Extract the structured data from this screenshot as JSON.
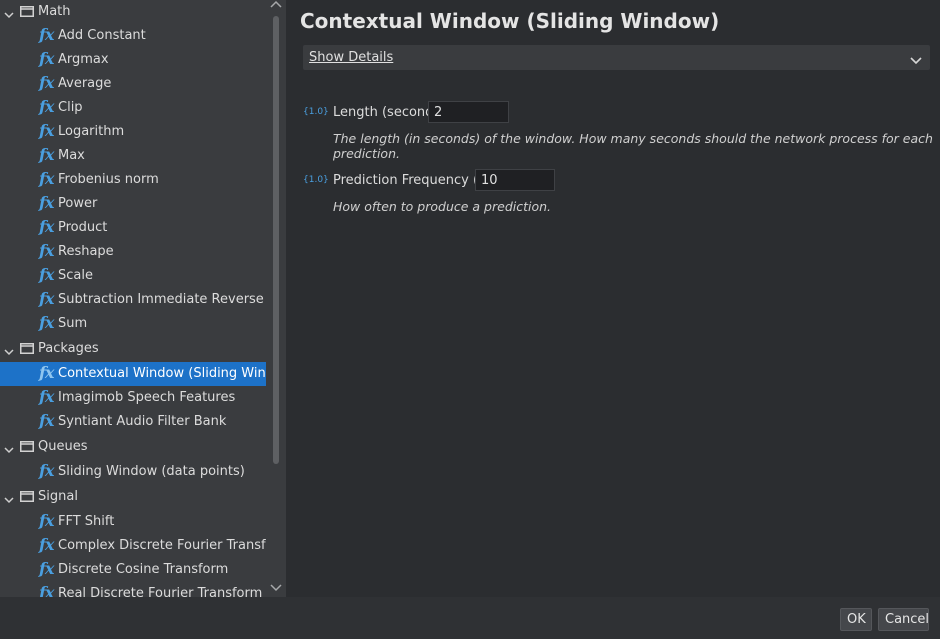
{
  "sidebar": {
    "rows": [
      {
        "kind": "folder",
        "label": "Math"
      },
      {
        "kind": "item",
        "label": "Add Constant"
      },
      {
        "kind": "item",
        "label": "Argmax"
      },
      {
        "kind": "item",
        "label": "Average"
      },
      {
        "kind": "item",
        "label": "Clip"
      },
      {
        "kind": "item",
        "label": "Logarithm"
      },
      {
        "kind": "item",
        "label": "Max"
      },
      {
        "kind": "item",
        "label": "Frobenius norm"
      },
      {
        "kind": "item",
        "label": "Power"
      },
      {
        "kind": "item",
        "label": "Product"
      },
      {
        "kind": "item",
        "label": "Reshape"
      },
      {
        "kind": "item",
        "label": "Scale"
      },
      {
        "kind": "item",
        "label": "Subtraction Immediate Reverse (A-x)"
      },
      {
        "kind": "item",
        "label": "Sum"
      },
      {
        "kind": "folder",
        "label": "Packages"
      },
      {
        "kind": "item",
        "label": "Contextual Window (Sliding Window)",
        "selected": true
      },
      {
        "kind": "item",
        "label": "Imagimob Speech Features"
      },
      {
        "kind": "item",
        "label": "Syntiant Audio Filter Bank"
      },
      {
        "kind": "folder",
        "label": "Queues"
      },
      {
        "kind": "item",
        "label": "Sliding Window (data points)"
      },
      {
        "kind": "folder",
        "label": "Signal"
      },
      {
        "kind": "item",
        "label": "FFT Shift"
      },
      {
        "kind": "item",
        "label": "Complex Discrete Fourier Transform"
      },
      {
        "kind": "item",
        "label": "Discrete Cosine Transform"
      },
      {
        "kind": "item",
        "label": "Real Discrete Fourier Transform"
      }
    ],
    "fx_glyph": "fx"
  },
  "main": {
    "title": "Contextual Window (Sliding Window)",
    "show_details": "Show Details",
    "params": [
      {
        "badge": "{1.0}",
        "label": "Length (seconds)",
        "value": "2",
        "description": "The length (in seconds) of the window. How many seconds should the network process for each prediction."
      },
      {
        "badge": "{1.0}",
        "label": "Prediction Frequency (Hz)",
        "value": "10",
        "description": "How often to produce a prediction."
      }
    ]
  },
  "footer": {
    "ok": "OK",
    "cancel": "Cancel"
  },
  "colors": {
    "accent": "#1d72c8",
    "fx_icon": "#4a9fe0",
    "background": "#2b2d30",
    "panel": "#3a3c3f"
  }
}
